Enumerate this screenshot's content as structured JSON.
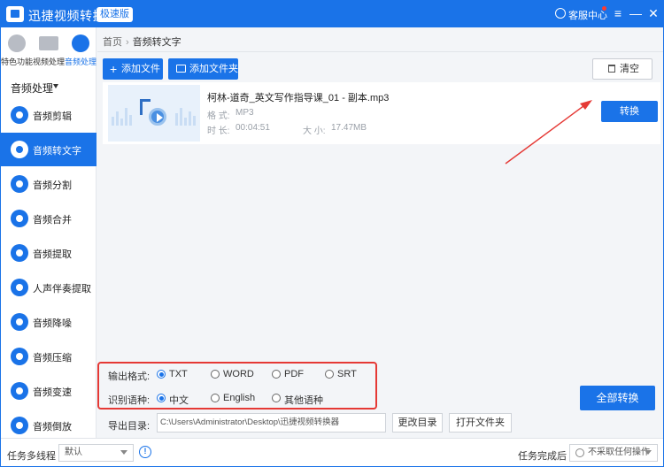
{
  "titlebar": {
    "app_name": "迅捷视频转换器",
    "edition_badge": "极速版",
    "support_label": "客服中心",
    "min_glyph": "—",
    "max_glyph": "☐",
    "close_glyph": "✕",
    "menu_glyph": "≡"
  },
  "sidebar": {
    "top_tabs": [
      {
        "label": "特色功能",
        "icon": "star-icon"
      },
      {
        "label": "视频处理",
        "icon": "film-icon"
      },
      {
        "label": "音频处理",
        "icon": "music-icon"
      }
    ],
    "category_header": "音频处理",
    "items": [
      {
        "label": "音频剪辑"
      },
      {
        "label": "音频转文字"
      },
      {
        "label": "音频分割"
      },
      {
        "label": "音频合并"
      },
      {
        "label": "音频提取"
      },
      {
        "label": "人声伴奏提取"
      },
      {
        "label": "音频降噪"
      },
      {
        "label": "音频压缩"
      },
      {
        "label": "音频变速"
      },
      {
        "label": "音频倒放"
      }
    ],
    "active_index": 1
  },
  "breadcrumb": {
    "home": "首页",
    "separator": "›",
    "current": "音频转文字"
  },
  "toolbar": {
    "add_file": "添加文件",
    "add_folder": "添加文件夹",
    "clear": "清空"
  },
  "file": {
    "name": "柯林-道奇_英文写作指导课_01 - 副本.mp3",
    "format_label": "格  式:",
    "format_value": "MP3",
    "duration_label": "时  长:",
    "duration_value": "00:04:51",
    "size_label": "大  小:",
    "size_value": "17.47MB",
    "convert_label": "转换"
  },
  "options": {
    "output_format_label": "输出格式:",
    "formats": [
      "TXT",
      "WORD",
      "PDF",
      "SRT"
    ],
    "selected_format": "TXT",
    "language_label": "识别语种:",
    "languages": [
      "中文",
      "English",
      "其他语种"
    ],
    "selected_language": "中文"
  },
  "export": {
    "label": "导出目录:",
    "path": "C:\\Users\\Administrator\\Desktop\\迅捷视频转换器",
    "change_dir": "更改目录",
    "open_folder": "打开文件夹"
  },
  "convert_all": "全部转换",
  "bottom": {
    "threads_label": "任务多线程",
    "threads_value": "默认",
    "after_label": "任务完成后",
    "after_value": "不采取任何操作"
  },
  "colors": {
    "accent": "#1a73e8",
    "highlight_border": "#e53935"
  }
}
